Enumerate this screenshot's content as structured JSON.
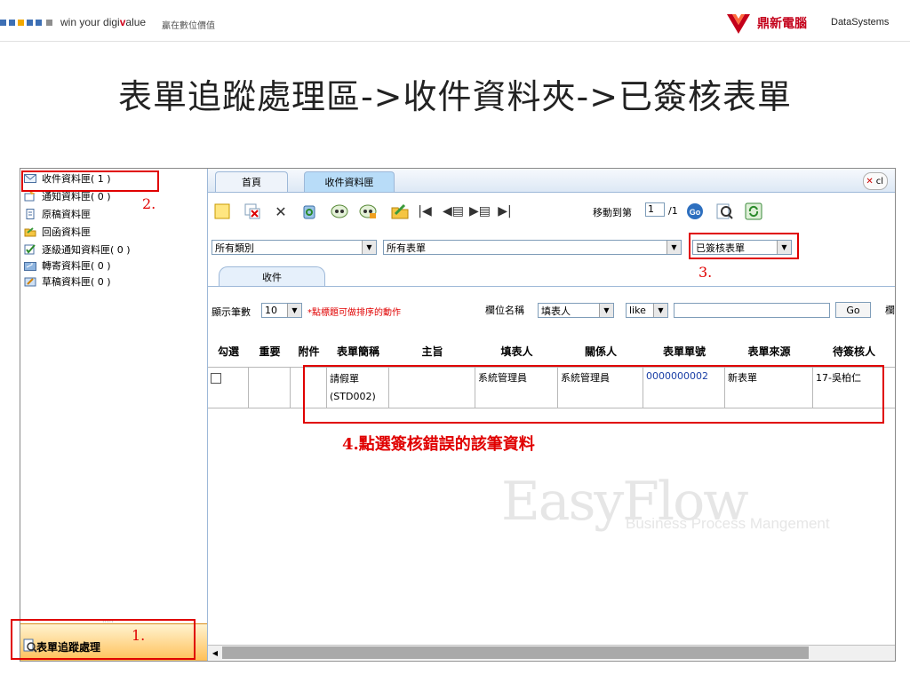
{
  "banner": {
    "slogan_prefix": "win your digi",
    "slogan_highlight": "v",
    "slogan_suffix": "alue",
    "slogan_cn": "贏在數位價值",
    "brand_cn": "鼎新電腦",
    "brand_en": "DataSystems",
    "square_colors": [
      "#3d6fb4",
      "#3d6fb4",
      "#f2a900",
      "#3d6fb4",
      "#3d6fb4",
      "#8e8e8e"
    ]
  },
  "slide_title": "表單追蹤處理區->收件資料夾->已簽核表單",
  "sidebar": {
    "items": [
      {
        "label": "收件資料匣( 1 )",
        "icon": "envelope-icon"
      },
      {
        "label": "通知資料匣( 0 )",
        "icon": "notify-icon"
      },
      {
        "label": "原稿資料匣",
        "icon": "document-icon"
      },
      {
        "label": "回函資料匣",
        "icon": "reply-folder-icon"
      },
      {
        "label": "逐級通知資料匣( 0 )",
        "icon": "checklist-icon"
      },
      {
        "label": "轉寄資料匣( 0 )",
        "icon": "forward-icon"
      },
      {
        "label": "草稿資料匣( 0 )",
        "icon": "draft-icon"
      }
    ],
    "bottom_label": "表單追蹤處理",
    "grip": "·····"
  },
  "tabs": [
    {
      "label": "首頁"
    },
    {
      "label": "收件資料匣"
    }
  ],
  "close_label": "cl",
  "toolbar": {
    "move_label": "移動到第",
    "page_value": "1",
    "page_total": "/1"
  },
  "filters": {
    "category": "所有類別",
    "form": "所有表單",
    "status": "已簽核表單"
  },
  "subtab": "收件",
  "controls": {
    "show_count_label": "顯示筆數",
    "show_count_value": "10",
    "sort_hint": "*點標題可做排序的動作",
    "field_label": "欄位名稱",
    "field_value": "填表人",
    "operator_value": "like",
    "search_value": "",
    "go_label": "Go",
    "cut_label": "欄"
  },
  "table": {
    "headers": [
      "勾選",
      "重要",
      "附件",
      "表單簡稱",
      "主旨",
      "填表人",
      "關係人",
      "表單單號",
      "表單來源",
      "待簽核人"
    ],
    "rows": [
      [
        "",
        "",
        "",
        "請假單\n(STD002)",
        "",
        "系統管理員",
        "系統管理員",
        "0000000002",
        "新表單",
        "17-吳柏仁"
      ]
    ]
  },
  "watermark": {
    "title": "EasyFlow",
    "subtitle": "Business Process Mangement"
  },
  "annotations": {
    "step1": "1.",
    "step2": "2.",
    "step3": "3.",
    "step4": "4.點選簽核錯誤的該筆資料"
  },
  "colors": {
    "annotation_red": "#e00000",
    "tab_active": "#b8dcf8",
    "bottom_panel": "#ffbf55"
  }
}
